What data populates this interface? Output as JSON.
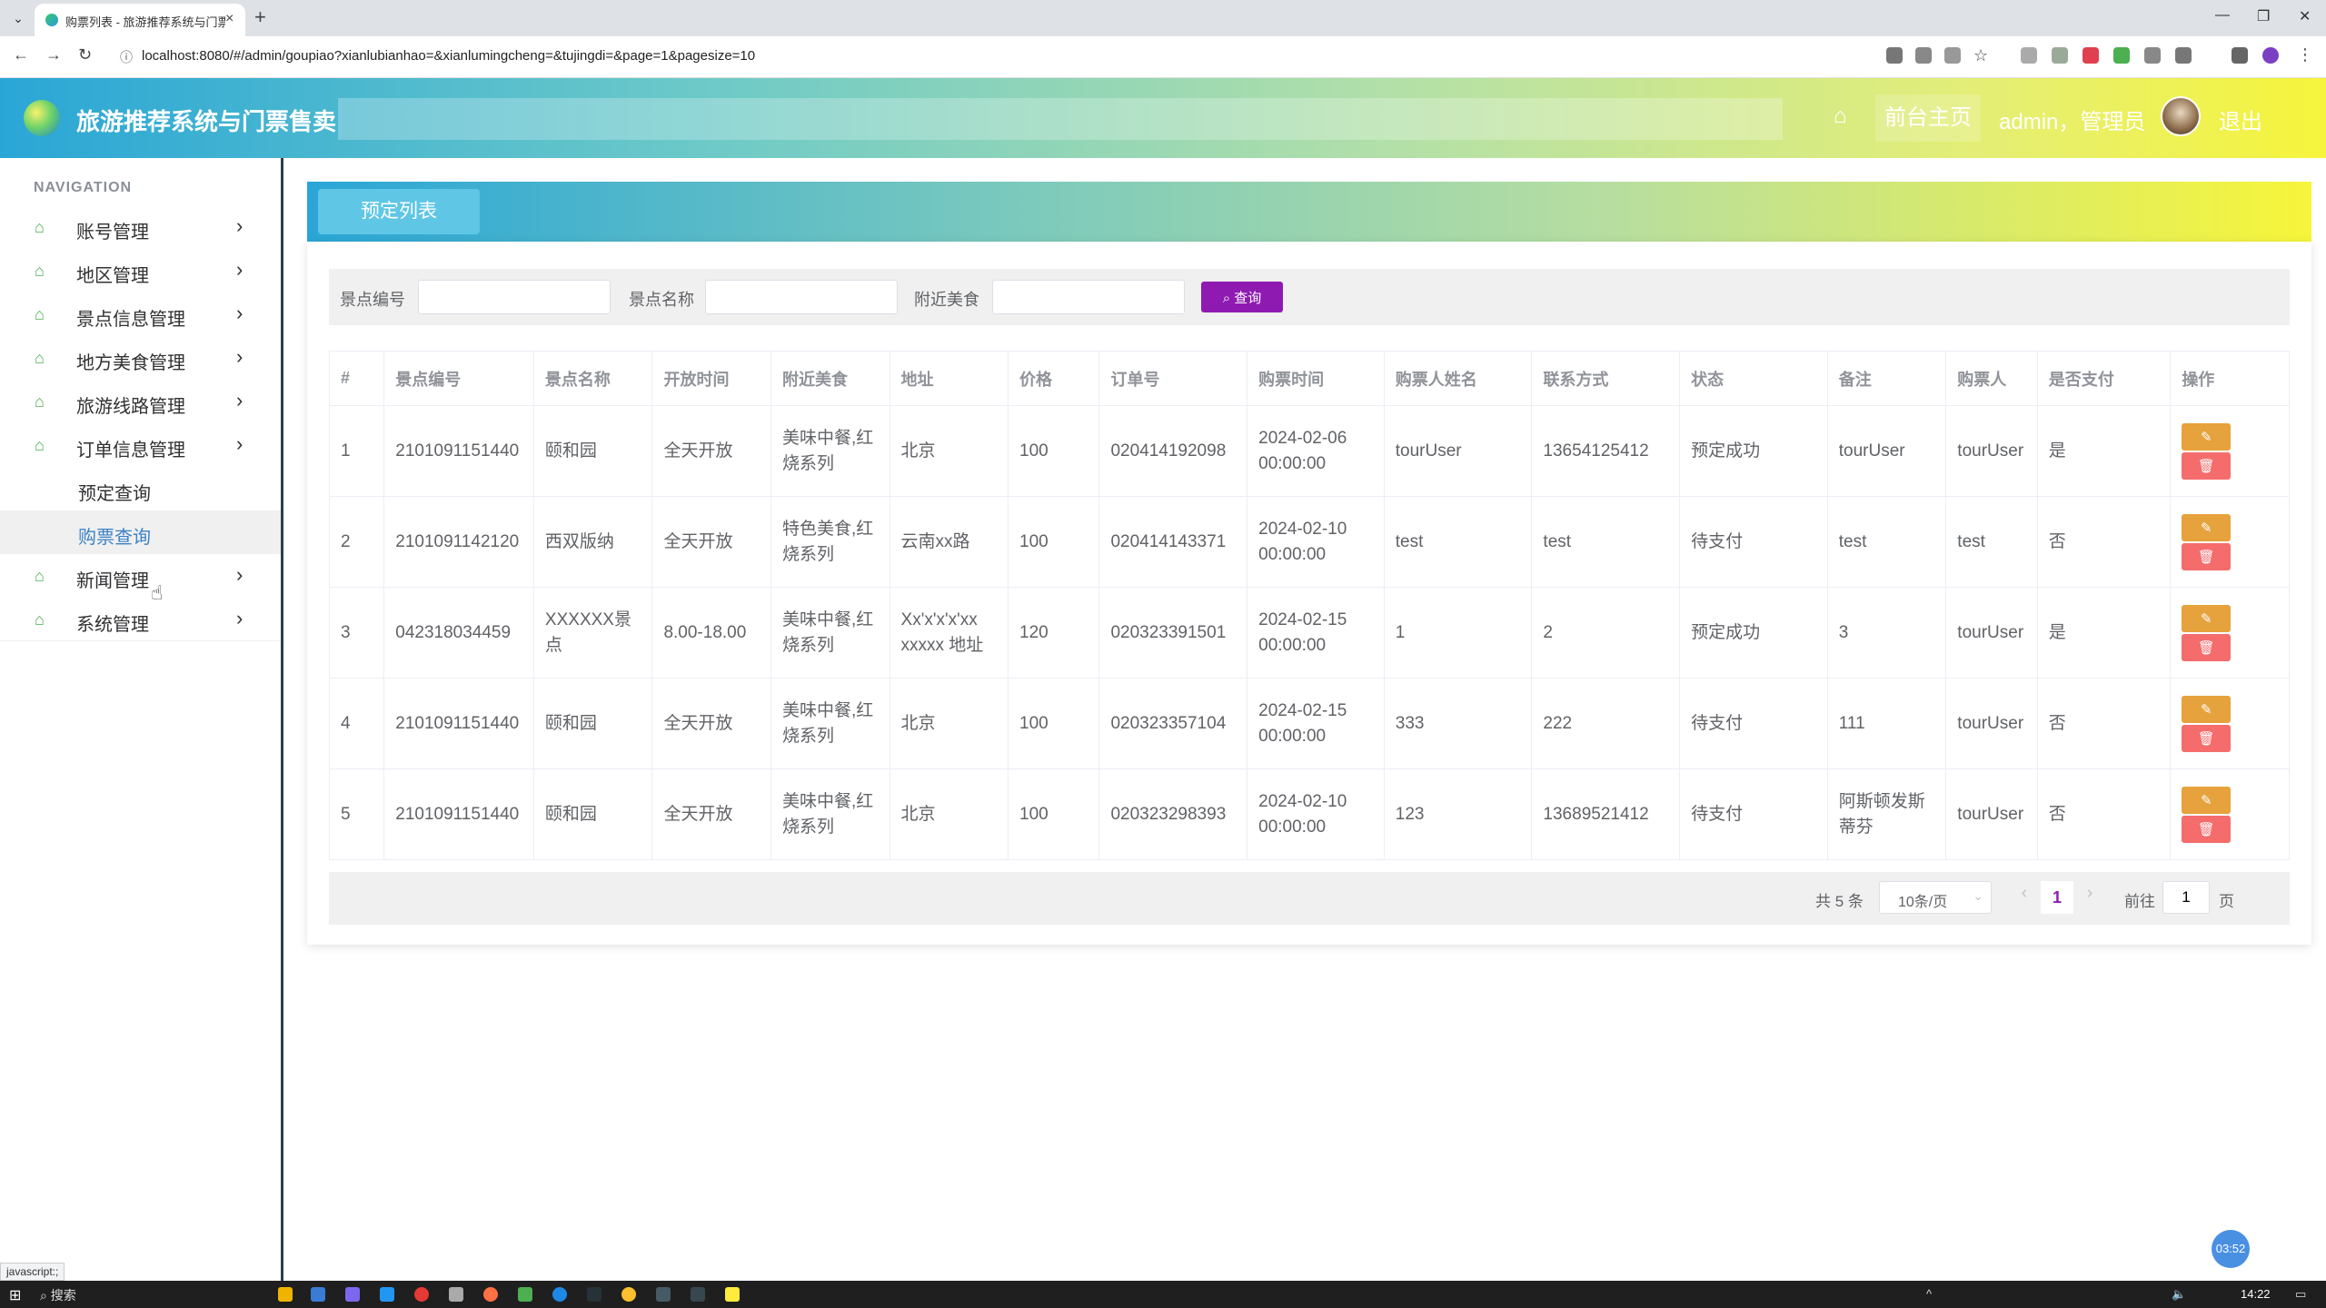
{
  "browser": {
    "tab_title": "购票列表 - 旅游推荐系统与门票",
    "url": "localhost:8080/#/admin/goupiao?xianlubianhao=&xianlumingcheng=&tujingdi=&page=1&pagesize=10",
    "status_hint": "javascript:;"
  },
  "header": {
    "title": "旅游推荐系统与门票售卖",
    "front_link": "前台主页",
    "user": "admin，管理员",
    "logout": "退出"
  },
  "sidebar": {
    "caption": "NAVIGATION",
    "items": [
      {
        "label": "账号管理"
      },
      {
        "label": "地区管理"
      },
      {
        "label": "景点信息管理"
      },
      {
        "label": "地方美食管理"
      },
      {
        "label": "旅游线路管理"
      },
      {
        "label": "订单信息管理"
      },
      {
        "label": "新闻管理"
      },
      {
        "label": "系统管理"
      }
    ],
    "sub_items": [
      {
        "label": "预定查询"
      },
      {
        "label": "购票查询"
      }
    ]
  },
  "main": {
    "tab_label": "预定列表",
    "search": {
      "label1": "景点编号",
      "label2": "景点名称",
      "label3": "附近美食",
      "button": "查询"
    },
    "columns": [
      "#",
      "景点编号",
      "景点名称",
      "开放时间",
      "附近美食",
      "地址",
      "价格",
      "订单号",
      "购票时间",
      "购票人姓名",
      "联系方式",
      "状态",
      "备注",
      "购票人",
      "是否支付",
      "操作"
    ],
    "rows": [
      [
        "1",
        "2101091151440",
        "颐和园",
        "全天开放",
        "美味中餐,红烧系列",
        "北京",
        "100",
        "020414192098",
        "2024-02-06 00:00:00",
        "tourUser",
        "13654125412",
        "预定成功",
        "tourUser",
        "tourUser",
        "是"
      ],
      [
        "2",
        "2101091142120",
        "西双版纳",
        "全天开放",
        "特色美食,红烧系列",
        "云南xx路",
        "100",
        "020414143371",
        "2024-02-10 00:00:00",
        "test",
        "test",
        "待支付",
        "test",
        "test",
        "否"
      ],
      [
        "3",
        "042318034459",
        "XXXXXX景点",
        "8.00-18.00",
        "美味中餐,红烧系列",
        "Xx'x'x'x'xx xxxxx 地址",
        "120",
        "020323391501",
        "2024-02-15 00:00:00",
        "1",
        "2",
        "预定成功",
        "3",
        "tourUser",
        "是"
      ],
      [
        "4",
        "2101091151440",
        "颐和园",
        "全天开放",
        "美味中餐,红烧系列",
        "北京",
        "100",
        "020323357104",
        "2024-02-15 00:00:00",
        "333",
        "222",
        "待支付",
        "111",
        "tourUser",
        "否"
      ],
      [
        "5",
        "2101091151440",
        "颐和园",
        "全天开放",
        "美味中餐,红烧系列",
        "北京",
        "100",
        "020323298393",
        "2024-02-10 00:00:00",
        "123",
        "13689521412",
        "待支付",
        "阿斯顿发斯蒂芬",
        "tourUser",
        "否"
      ]
    ],
    "pager": {
      "total": "共 5 条",
      "page_size": "10条/页",
      "current": "1",
      "jump_prefix": "前往",
      "jump_value": "1",
      "jump_suffix": "页"
    }
  },
  "float_badge": "03:52",
  "taskbar": {
    "search": "搜索",
    "clock": "14:22"
  },
  "colors": {
    "accent_purple": "#8e1ab2",
    "edit_orange": "#e6a23c",
    "delete_red": "#f56c6c",
    "menu_icon_green": "#4caf50",
    "active_link_blue": "#3b82c4"
  }
}
